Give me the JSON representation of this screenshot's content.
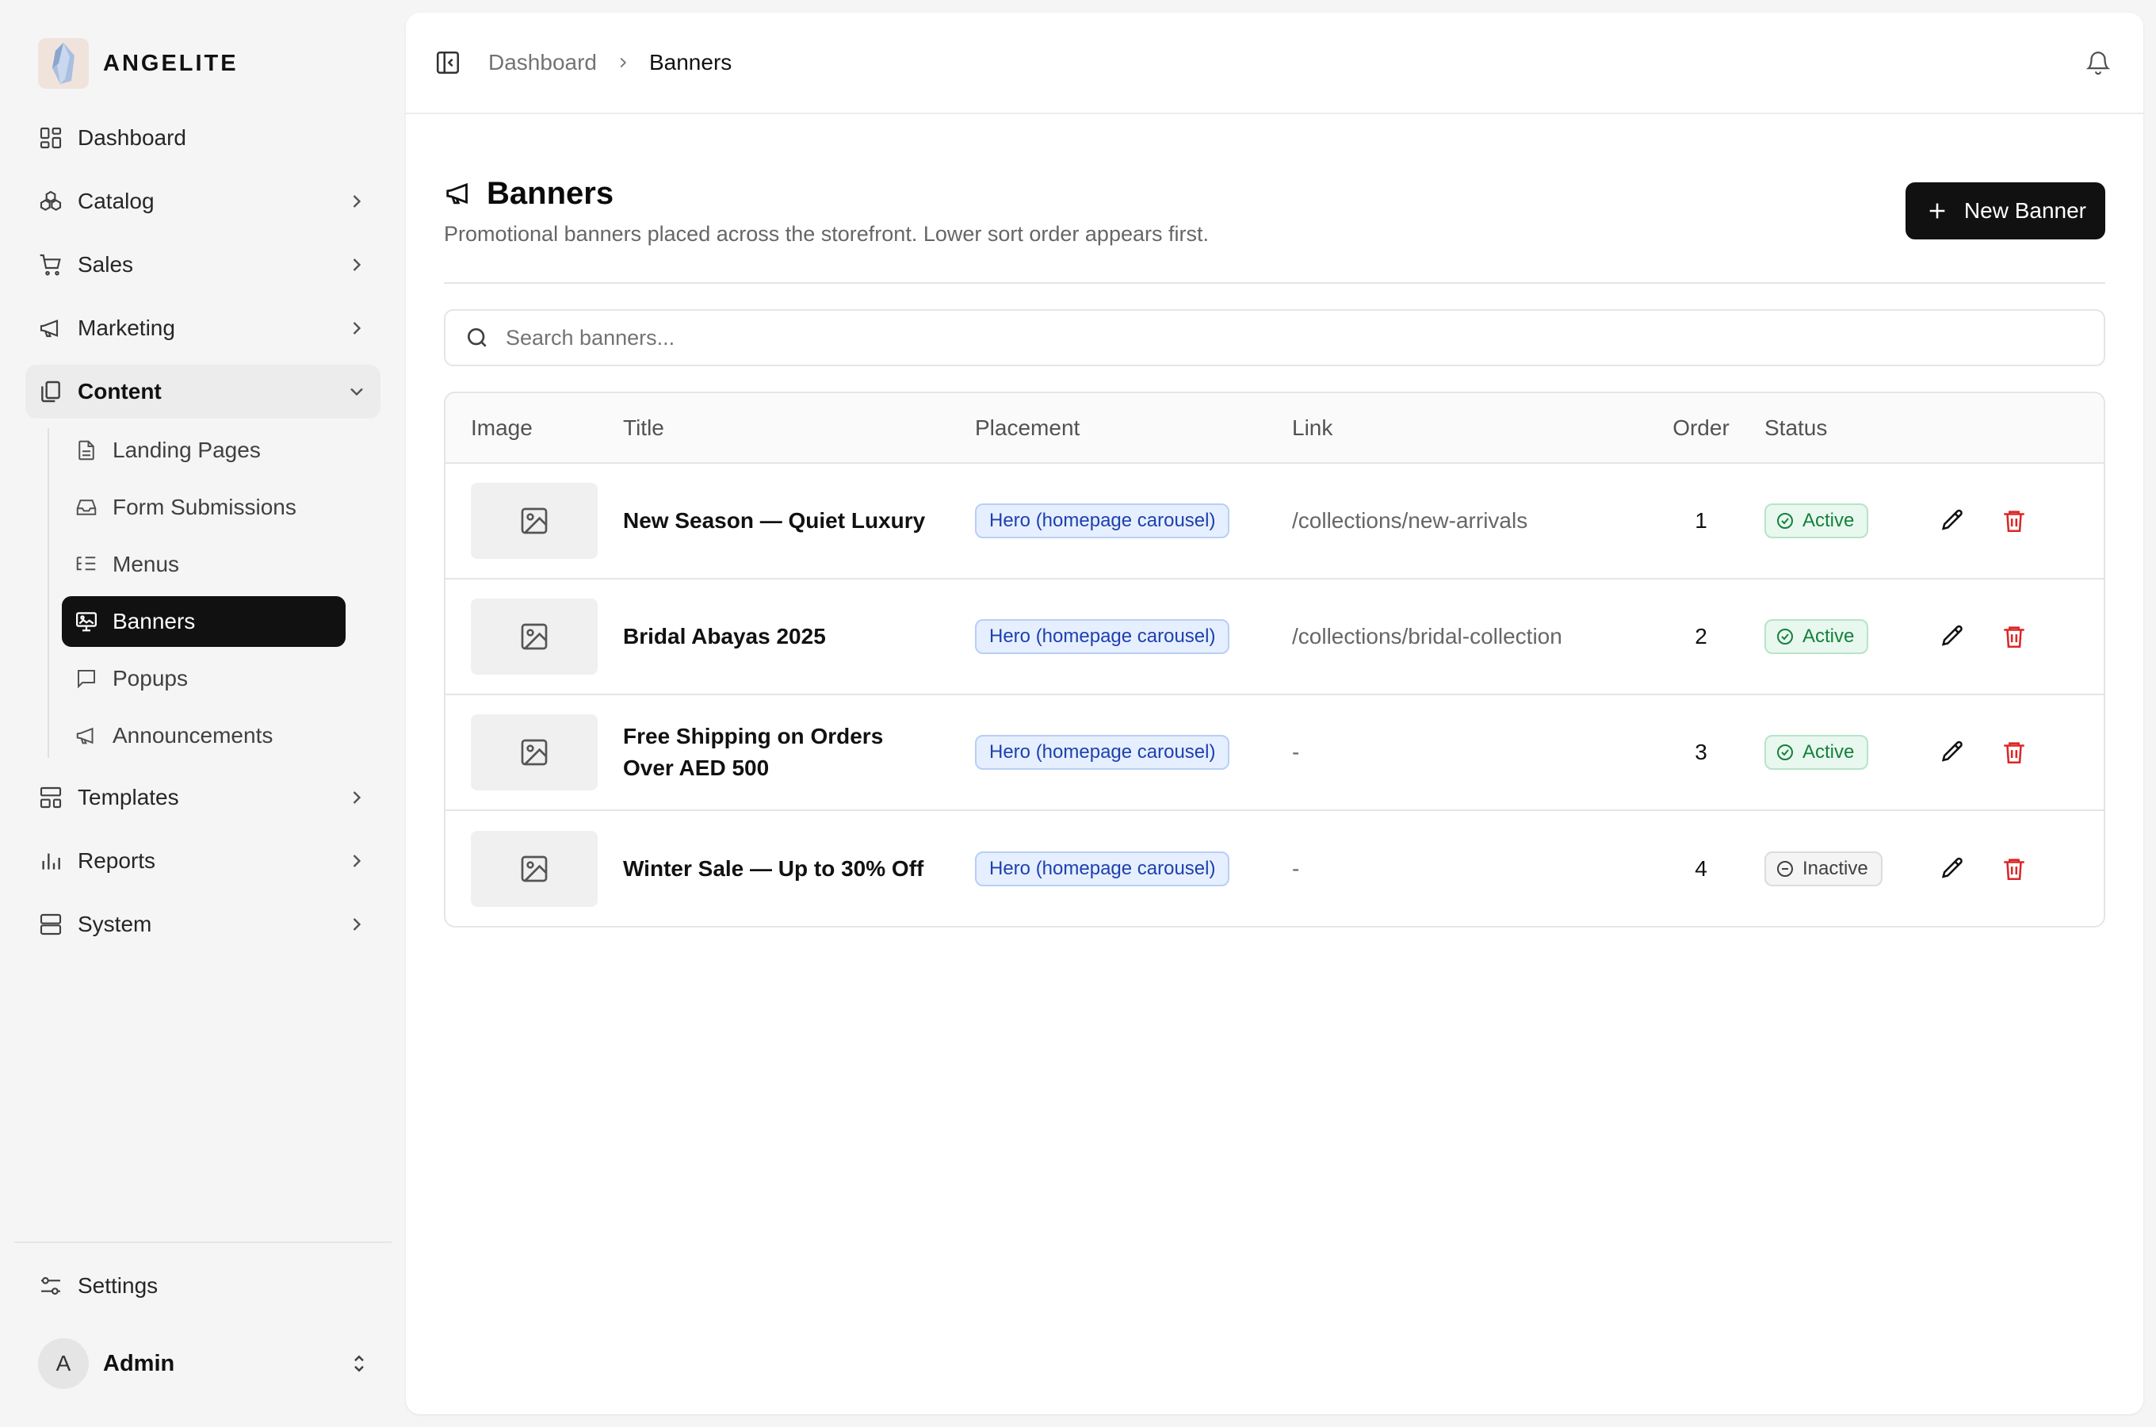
{
  "brand": {
    "name": "ANGELITE"
  },
  "sidebar": {
    "items": [
      {
        "label": "Dashboard",
        "icon": "dashboard-icon"
      },
      {
        "label": "Catalog",
        "icon": "catalog-icon"
      },
      {
        "label": "Sales",
        "icon": "cart-icon"
      },
      {
        "label": "Marketing",
        "icon": "megaphone-icon"
      },
      {
        "label": "Content",
        "icon": "content-icon"
      },
      {
        "label": "Templates",
        "icon": "templates-icon"
      },
      {
        "label": "Reports",
        "icon": "reports-icon"
      },
      {
        "label": "System",
        "icon": "system-icon"
      }
    ],
    "content_children": [
      {
        "label": "Landing Pages",
        "icon": "file-icon"
      },
      {
        "label": "Form Submissions",
        "icon": "inbox-icon"
      },
      {
        "label": "Menus",
        "icon": "list-tree-icon"
      },
      {
        "label": "Banners",
        "icon": "monitor-image-icon"
      },
      {
        "label": "Popups",
        "icon": "message-square-icon"
      },
      {
        "label": "Announcements",
        "icon": "megaphone-icon"
      }
    ],
    "settings_label": "Settings",
    "user": {
      "initial": "A",
      "name": "Admin"
    }
  },
  "breadcrumb": {
    "parent": "Dashboard",
    "current": "Banners"
  },
  "page": {
    "title": "Banners",
    "description": "Promotional banners placed across the storefront. Lower sort order appears first.",
    "new_button": "New Banner"
  },
  "search": {
    "placeholder": "Search banners..."
  },
  "table": {
    "columns": [
      "Image",
      "Title",
      "Placement",
      "Link",
      "Order",
      "Status"
    ],
    "rows": [
      {
        "title": "New Season — Quiet Luxury",
        "placement": "Hero (homepage carousel)",
        "link": "/collections/new-arrivals",
        "order": "1",
        "status": "Active"
      },
      {
        "title": "Bridal Abayas 2025",
        "placement": "Hero (homepage carousel)",
        "link": "/collections/bridal-collection",
        "order": "2",
        "status": "Active"
      },
      {
        "title": "Free Shipping on Orders Over AED 500",
        "placement": "Hero (homepage carousel)",
        "link": "-",
        "order": "3",
        "status": "Active"
      },
      {
        "title": "Winter Sale — Up to 30% Off",
        "placement": "Hero (homepage carousel)",
        "link": "-",
        "order": "4",
        "status": "Inactive"
      }
    ]
  },
  "colors": {
    "accent": "#111111",
    "placement_badge": "#1e40af",
    "status_active": "#15803d",
    "status_inactive": "#404040",
    "delete": "#dc2626"
  }
}
